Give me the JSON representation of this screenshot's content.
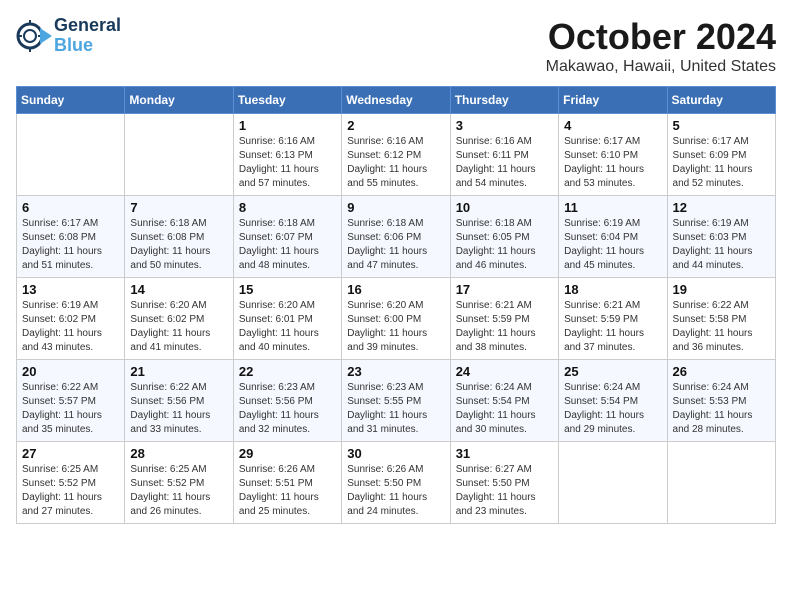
{
  "logo": {
    "line1": "General",
    "line2": "Blue"
  },
  "title": "October 2024",
  "location": "Makawao, Hawaii, United States",
  "weekdays": [
    "Sunday",
    "Monday",
    "Tuesday",
    "Wednesday",
    "Thursday",
    "Friday",
    "Saturday"
  ],
  "weeks": [
    [
      {
        "day": "",
        "info": ""
      },
      {
        "day": "",
        "info": ""
      },
      {
        "day": "1",
        "info": "Sunrise: 6:16 AM\nSunset: 6:13 PM\nDaylight: 11 hours and 57 minutes."
      },
      {
        "day": "2",
        "info": "Sunrise: 6:16 AM\nSunset: 6:12 PM\nDaylight: 11 hours and 55 minutes."
      },
      {
        "day": "3",
        "info": "Sunrise: 6:16 AM\nSunset: 6:11 PM\nDaylight: 11 hours and 54 minutes."
      },
      {
        "day": "4",
        "info": "Sunrise: 6:17 AM\nSunset: 6:10 PM\nDaylight: 11 hours and 53 minutes."
      },
      {
        "day": "5",
        "info": "Sunrise: 6:17 AM\nSunset: 6:09 PM\nDaylight: 11 hours and 52 minutes."
      }
    ],
    [
      {
        "day": "6",
        "info": "Sunrise: 6:17 AM\nSunset: 6:08 PM\nDaylight: 11 hours and 51 minutes."
      },
      {
        "day": "7",
        "info": "Sunrise: 6:18 AM\nSunset: 6:08 PM\nDaylight: 11 hours and 50 minutes."
      },
      {
        "day": "8",
        "info": "Sunrise: 6:18 AM\nSunset: 6:07 PM\nDaylight: 11 hours and 48 minutes."
      },
      {
        "day": "9",
        "info": "Sunrise: 6:18 AM\nSunset: 6:06 PM\nDaylight: 11 hours and 47 minutes."
      },
      {
        "day": "10",
        "info": "Sunrise: 6:18 AM\nSunset: 6:05 PM\nDaylight: 11 hours and 46 minutes."
      },
      {
        "day": "11",
        "info": "Sunrise: 6:19 AM\nSunset: 6:04 PM\nDaylight: 11 hours and 45 minutes."
      },
      {
        "day": "12",
        "info": "Sunrise: 6:19 AM\nSunset: 6:03 PM\nDaylight: 11 hours and 44 minutes."
      }
    ],
    [
      {
        "day": "13",
        "info": "Sunrise: 6:19 AM\nSunset: 6:02 PM\nDaylight: 11 hours and 43 minutes."
      },
      {
        "day": "14",
        "info": "Sunrise: 6:20 AM\nSunset: 6:02 PM\nDaylight: 11 hours and 41 minutes."
      },
      {
        "day": "15",
        "info": "Sunrise: 6:20 AM\nSunset: 6:01 PM\nDaylight: 11 hours and 40 minutes."
      },
      {
        "day": "16",
        "info": "Sunrise: 6:20 AM\nSunset: 6:00 PM\nDaylight: 11 hours and 39 minutes."
      },
      {
        "day": "17",
        "info": "Sunrise: 6:21 AM\nSunset: 5:59 PM\nDaylight: 11 hours and 38 minutes."
      },
      {
        "day": "18",
        "info": "Sunrise: 6:21 AM\nSunset: 5:59 PM\nDaylight: 11 hours and 37 minutes."
      },
      {
        "day": "19",
        "info": "Sunrise: 6:22 AM\nSunset: 5:58 PM\nDaylight: 11 hours and 36 minutes."
      }
    ],
    [
      {
        "day": "20",
        "info": "Sunrise: 6:22 AM\nSunset: 5:57 PM\nDaylight: 11 hours and 35 minutes."
      },
      {
        "day": "21",
        "info": "Sunrise: 6:22 AM\nSunset: 5:56 PM\nDaylight: 11 hours and 33 minutes."
      },
      {
        "day": "22",
        "info": "Sunrise: 6:23 AM\nSunset: 5:56 PM\nDaylight: 11 hours and 32 minutes."
      },
      {
        "day": "23",
        "info": "Sunrise: 6:23 AM\nSunset: 5:55 PM\nDaylight: 11 hours and 31 minutes."
      },
      {
        "day": "24",
        "info": "Sunrise: 6:24 AM\nSunset: 5:54 PM\nDaylight: 11 hours and 30 minutes."
      },
      {
        "day": "25",
        "info": "Sunrise: 6:24 AM\nSunset: 5:54 PM\nDaylight: 11 hours and 29 minutes."
      },
      {
        "day": "26",
        "info": "Sunrise: 6:24 AM\nSunset: 5:53 PM\nDaylight: 11 hours and 28 minutes."
      }
    ],
    [
      {
        "day": "27",
        "info": "Sunrise: 6:25 AM\nSunset: 5:52 PM\nDaylight: 11 hours and 27 minutes."
      },
      {
        "day": "28",
        "info": "Sunrise: 6:25 AM\nSunset: 5:52 PM\nDaylight: 11 hours and 26 minutes."
      },
      {
        "day": "29",
        "info": "Sunrise: 6:26 AM\nSunset: 5:51 PM\nDaylight: 11 hours and 25 minutes."
      },
      {
        "day": "30",
        "info": "Sunrise: 6:26 AM\nSunset: 5:50 PM\nDaylight: 11 hours and 24 minutes."
      },
      {
        "day": "31",
        "info": "Sunrise: 6:27 AM\nSunset: 5:50 PM\nDaylight: 11 hours and 23 minutes."
      },
      {
        "day": "",
        "info": ""
      },
      {
        "day": "",
        "info": ""
      }
    ]
  ]
}
